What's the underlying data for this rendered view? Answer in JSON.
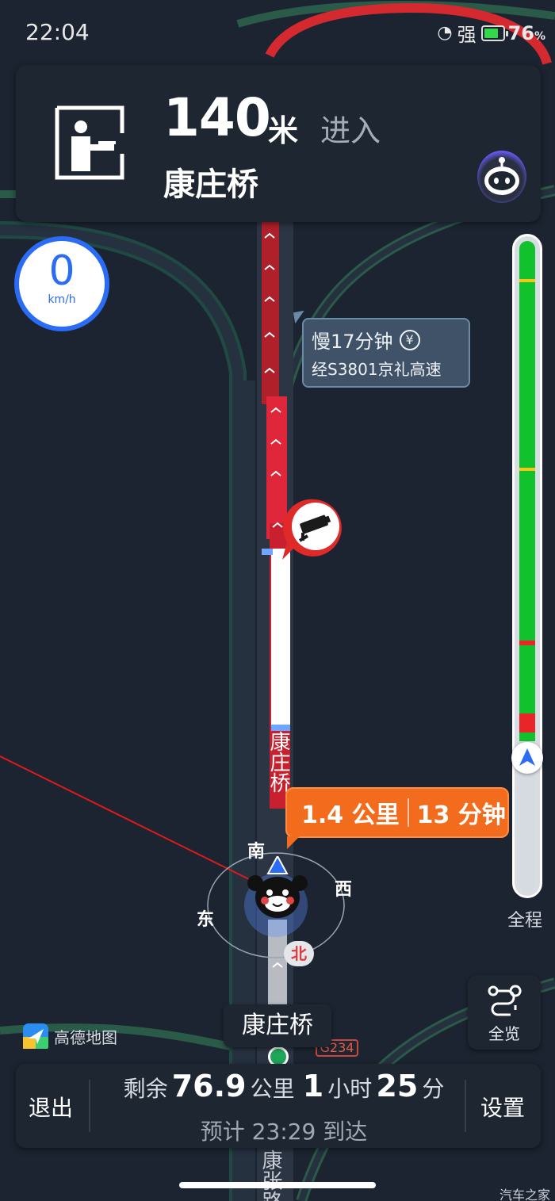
{
  "status_bar": {
    "time": "22:04",
    "signal_text": "强",
    "battery_percent": "76",
    "battery_unit": "%",
    "battery_level": 0.76
  },
  "nav_card": {
    "distance_value": "140",
    "distance_unit": "米",
    "action": "进入",
    "road_name": "康庄桥",
    "turn_icon": "toll-booth-icon"
  },
  "speed": {
    "value": "0",
    "unit": "km/h"
  },
  "alternative_route": {
    "line1": "慢17分钟",
    "toll_symbol": "¥",
    "line2": "经S3801京礼高速"
  },
  "map_labels": {
    "road_vertical": "康庄桥",
    "road_bottom": "康张路",
    "route_badge": "G234"
  },
  "eta_bubble": {
    "distance": "1.4 公里",
    "time": "13 分钟"
  },
  "compass": {
    "south": "南",
    "east": "东",
    "west": "西",
    "north": "北"
  },
  "progress": {
    "label": "全程",
    "traveled_fraction": 0.23,
    "colors": {
      "clear": "#12c22c",
      "slow": "#f5c518",
      "jam": "#e8262a",
      "traveled": "#d6dbe1"
    }
  },
  "overview": {
    "label": "全览"
  },
  "current_road": "康庄桥",
  "logo": {
    "text": "高德地图"
  },
  "bottom_bar": {
    "exit_label": "退出",
    "settings_label": "设置",
    "remain_prefix": "剩余",
    "remain_distance": "76.9",
    "remain_distance_unit": "公里",
    "remain_hours": "1",
    "remain_hours_unit": "小时",
    "remain_minutes": "25",
    "remain_minutes_unit": "分",
    "arrival_text": "预计 23:29 到达"
  },
  "watermark": "汽车之家",
  "colors": {
    "route_line": "#ffffff",
    "congestion": "#e0263a",
    "accent_blue": "#2a6cf5",
    "eta_orange": "#f36b1c"
  }
}
